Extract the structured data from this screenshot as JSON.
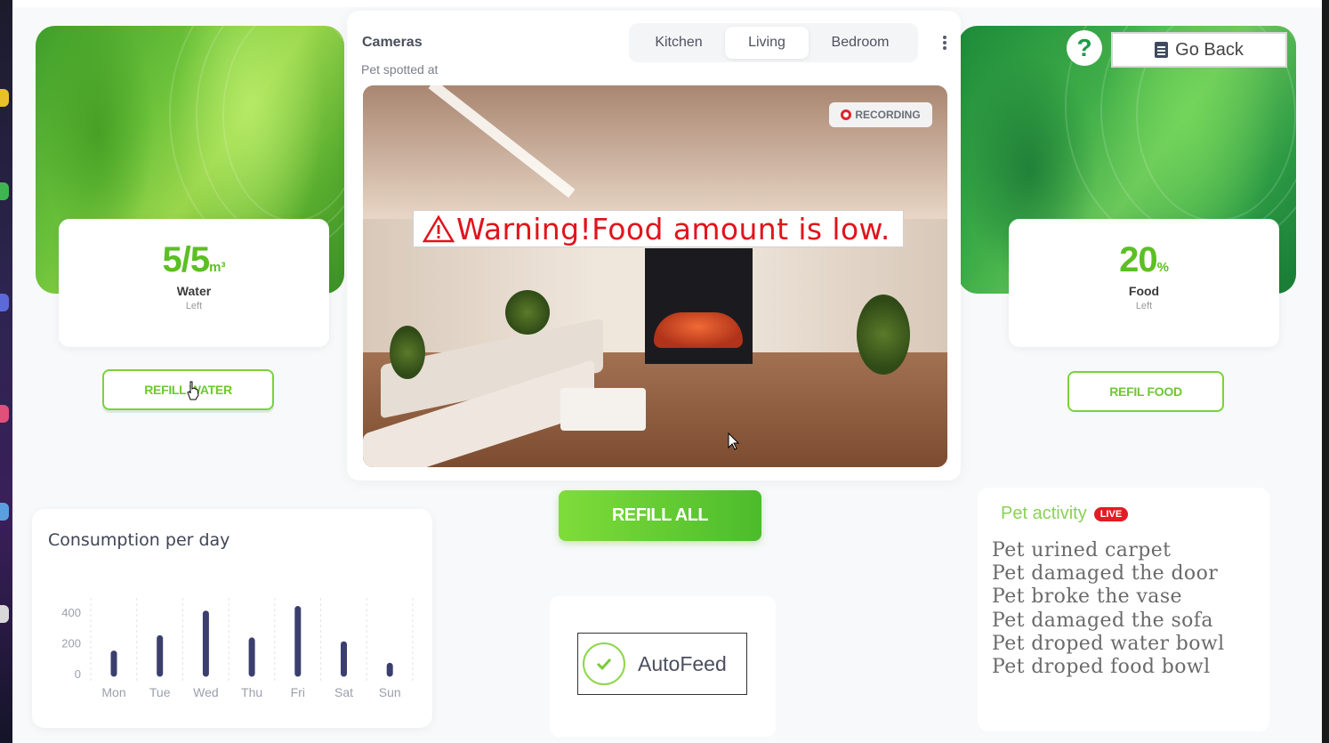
{
  "header": {
    "help_symbol": "?",
    "go_back_label": "Go Back"
  },
  "water": {
    "value": "5/5",
    "unit": "m³",
    "label": "Water",
    "sub": "Left",
    "refill_label": "REFILL WATER"
  },
  "food": {
    "value": "20",
    "unit": "%",
    "label": "Food",
    "sub": "Left",
    "refill_label": "REFIL FOOD"
  },
  "cameras": {
    "title": "Cameras",
    "subtitle": "Pet spotted at",
    "tabs": [
      {
        "label": "Kitchen",
        "active": false
      },
      {
        "label": "Living",
        "active": true
      },
      {
        "label": "Bedroom",
        "active": false
      }
    ],
    "recording_label": "RECORDING",
    "warning_text": "Warning!Food amount is low."
  },
  "actions": {
    "refill_all_label": "REFILL ALL",
    "autofeed_label": "AutoFeed",
    "autofeed_checked": true
  },
  "activity": {
    "title": "Pet activity",
    "live_label": "LIVE",
    "items": [
      "Pet urined carpet",
      "Pet damaged the door",
      "Pet broke the vase",
      "Pet damaged the sofa",
      "Pet droped water bowl",
      "Pet droped food bowl"
    ]
  },
  "colors": {
    "accent_green": "#6cc830",
    "bar_color": "#3b3f6e",
    "warning_red": "#e0141c",
    "live_red": "#e21c24"
  },
  "chart_data": {
    "type": "bar",
    "title": "Consumption per day",
    "categories": [
      "Mon",
      "Tue",
      "Wed",
      "Thu",
      "Fri",
      "Sat",
      "Sun"
    ],
    "values": [
      130,
      230,
      390,
      215,
      420,
      190,
      50
    ],
    "yticks": [
      0,
      200,
      400
    ],
    "ylim": [
      0,
      400
    ],
    "xlabel": "",
    "ylabel": "",
    "grid": "vertical dashed"
  }
}
